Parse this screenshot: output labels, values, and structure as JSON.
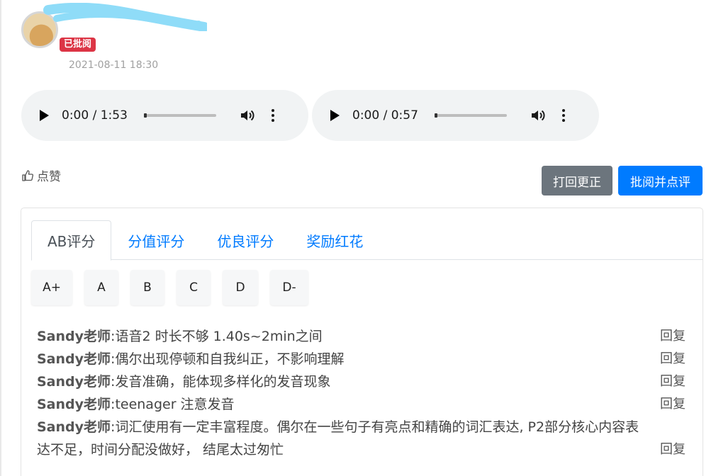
{
  "post": {
    "badge": "已批阅",
    "time": "2021-08-11 18:30"
  },
  "audios": [
    {
      "time": "0:00 / 1:53",
      "progress": 0
    },
    {
      "time": "0:00 / 0:57",
      "progress": 0
    }
  ],
  "actions": {
    "like_label": "点赞",
    "return_label": "打回更正",
    "review_label": "批阅并点评"
  },
  "tabs": [
    {
      "label": "AB评分",
      "active": true
    },
    {
      "label": "分值评分",
      "active": false
    },
    {
      "label": "优良评分",
      "active": false
    },
    {
      "label": "奖励红花",
      "active": false
    }
  ],
  "grades": [
    "A+",
    "A",
    "B",
    "C",
    "D",
    "D-"
  ],
  "comments": [
    {
      "author": "Sandy老师",
      "sep": ":",
      "text": "语音2 时长不够 1.40s~2min之间",
      "reply": "回复"
    },
    {
      "author": "Sandy老师",
      "sep": ":",
      "text": "偶尔出现停顿和自我纠正，不影响理解",
      "reply": "回复"
    },
    {
      "author": "Sandy老师",
      "sep": ":",
      "text": "发音准确，能体现多样化的发音现象",
      "reply": "回复"
    },
    {
      "author": "Sandy老师",
      "sep": ":",
      "text": "teenager 注意发音",
      "reply": "回复"
    },
    {
      "author": "Sandy老师",
      "sep": ":",
      "text": "词汇使用有一定丰富程度。偶尔在一些句子有亮点和精确的词汇表达, P2部分核心内容表达不足，时间分配没做好， 结尾太过匆忙",
      "reply": "回复"
    }
  ],
  "colors": {
    "badge": "#dc3545",
    "primary": "#007bff",
    "secondary": "#6c757d",
    "audio_bg": "#f1f3f4"
  }
}
